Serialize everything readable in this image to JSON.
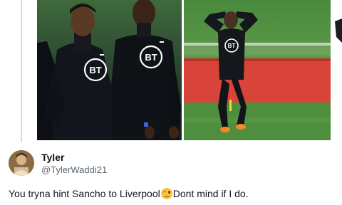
{
  "tweet": {
    "display_name": "Tyler",
    "handle": "@TylerWaddi21",
    "text_before_emoji": "You tryna hint Sancho to Liverpool",
    "emoji": "winking-face",
    "text_after_emoji": "Dont mind if I do."
  },
  "media": {
    "photo_left": {
      "logo_text": "BT",
      "logo_text_2": "BT"
    },
    "photo_right": {
      "logo_text": "BT"
    }
  }
}
